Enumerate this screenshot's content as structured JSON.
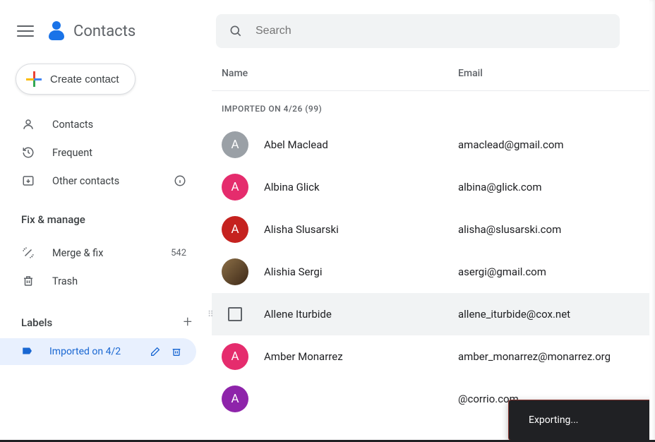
{
  "header": {
    "title": "Contacts"
  },
  "search": {
    "placeholder": "Search"
  },
  "create": {
    "label": "Create contact"
  },
  "nav": {
    "contacts": "Contacts",
    "frequent": "Frequent",
    "other": "Other contacts"
  },
  "fix_manage": {
    "title": "Fix & manage",
    "merge": "Merge & fix",
    "merge_count": "542",
    "trash": "Trash"
  },
  "labels": {
    "title": "Labels",
    "items": [
      {
        "name": "Imported on 4/2"
      }
    ]
  },
  "columns": {
    "name": "Name",
    "email": "Email"
  },
  "list_header": "IMPORTED ON 4/26 (99)",
  "contacts": [
    {
      "initial": "A",
      "color": "#9AA0A6",
      "name": "Abel Maclead",
      "email": "amaclead@gmail.com"
    },
    {
      "initial": "A",
      "color": "#E52C6D",
      "name": "Albina Glick",
      "email": "albina@glick.com"
    },
    {
      "initial": "A",
      "color": "#C5221F",
      "name": "Alisha Slusarski",
      "email": "alisha@slusarski.com"
    },
    {
      "initial": "",
      "color": "photo",
      "name": "Alishia Sergi",
      "email": "asergi@gmail.com"
    },
    {
      "initial": "",
      "color": "",
      "name": "Allene Iturbide",
      "email": "allene_iturbide@cox.net",
      "hover": true
    },
    {
      "initial": "A",
      "color": "#E52C6D",
      "name": "Amber Monarrez",
      "email": "amber_monarrez@monarrez.org"
    },
    {
      "initial": "A",
      "color": "#8E24AA",
      "name": "",
      "email": "@corrio.com"
    }
  ],
  "toast": {
    "text": "Exporting..."
  }
}
